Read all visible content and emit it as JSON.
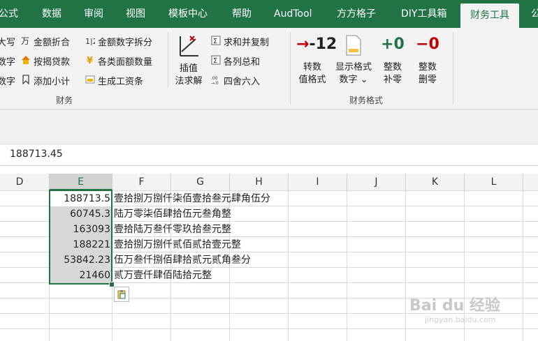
{
  "tabs": [
    "公式",
    "数据",
    "审阅",
    "视图",
    "模板中心",
    "帮助",
    "AudTool",
    "方方格子",
    "DIY工具箱",
    "财务工具",
    "公"
  ],
  "ribbon": {
    "left_col": [
      "大写",
      "数字",
      "数字"
    ],
    "col1": [
      "金额折合",
      "按揭贷款",
      "添加小计"
    ],
    "col2": [
      "金额数字拆分",
      "各类面额数量",
      "生成工资条"
    ],
    "interp_label1": "插值",
    "interp_label2": "法求解",
    "col3": [
      "求和并复制",
      "各列总和",
      "四舍六入"
    ],
    "group1_label": "财务",
    "fmt_buttons": [
      {
        "num": "-12",
        "label1": "转数",
        "label2": "值格式"
      },
      {
        "num": "",
        "label1": "显示格式",
        "label2": "数字 ⌄"
      },
      {
        "num": "+0",
        "label1": "整数",
        "label2": "补零"
      },
      {
        "num": "−0",
        "label1": "整数",
        "label2": "删零"
      }
    ],
    "group2_label": "财务格式"
  },
  "formula_bar": {
    "value": "188713.45"
  },
  "columns": [
    "D",
    "E",
    "F",
    "G",
    "H",
    "I",
    "J",
    "K",
    "L"
  ],
  "rows": [
    {
      "value": "188713.5",
      "text": "壹拾捌万捌仟柒佰壹拾叁元肆角伍分"
    },
    {
      "value": "60745.3",
      "text": "陆万零柒佰肆拾伍元叁角整"
    },
    {
      "value": "163093",
      "text": "壹拾陆万叁仟零玖拾叁元整"
    },
    {
      "value": "188221",
      "text": "壹拾捌万捌仟贰佰贰拾壹元整"
    },
    {
      "value": "53842.23",
      "text": "伍万叁仟捌佰肆拾贰元贰角叁分"
    },
    {
      "value": "21460",
      "text": "贰万壹仟肆佰陆拾元整"
    }
  ],
  "watermark": {
    "line1": "Bai du 经验",
    "line2": "jingyan.baidu.com"
  },
  "colors": {
    "ribbon_green": "#217346",
    "minus_red": "#c00000",
    "plus_green": "#217346"
  }
}
